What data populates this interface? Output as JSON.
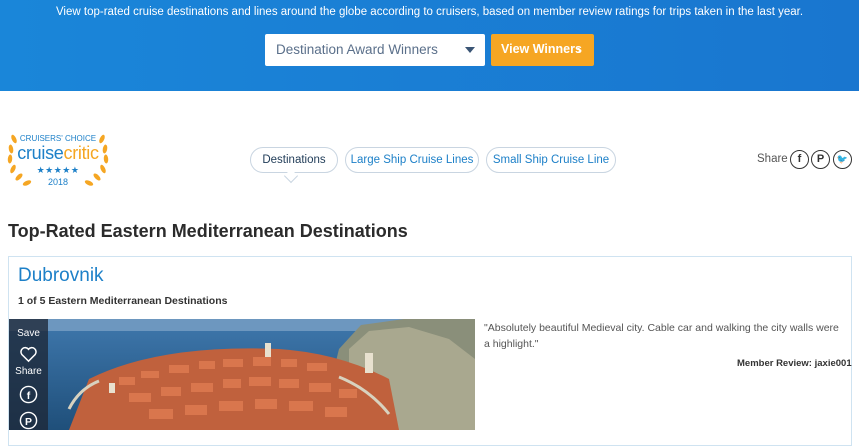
{
  "hero": {
    "text": "View top-rated cruise destinations and lines around the globe according to cruisers, based on member review ratings for trips taken in the last year.",
    "select_value": "Destination Award Winners",
    "cta_label": "View Winners",
    "cta_chevron": "›"
  },
  "badge": {
    "line1": "CRUISERS' CHOICE",
    "logo_a": "cruise",
    "logo_b": "critic",
    "stars": "★★★★★",
    "year": "2018"
  },
  "tabs": [
    {
      "label": "Destinations",
      "active": true
    },
    {
      "label": "Large Ship Cruise Lines",
      "active": false
    },
    {
      "label": "Small Ship Cruise Line",
      "active": false
    }
  ],
  "share": {
    "label": "Share",
    "icons": [
      "facebook-icon",
      "pinterest-icon",
      "twitter-icon"
    ]
  },
  "section_title": "Top-Rated Eastern Mediterranean Destinations",
  "card": {
    "title": "Dubrovnik",
    "subtitle": "1 of 5 Eastern Mediterranean Destinations",
    "save_label": "Save",
    "share_label": "Share",
    "quote": "\"Absolutely beautiful Medieval city. Cable car and walking the city walls were a highlight.\"",
    "review_label": "Member Review:",
    "reviewer": "jaxie001"
  },
  "colors": {
    "hero_blue": "#1a86d9",
    "cta_orange": "#f6a623",
    "link_blue": "#1d80c8",
    "badge_gold": "#f5a623"
  }
}
